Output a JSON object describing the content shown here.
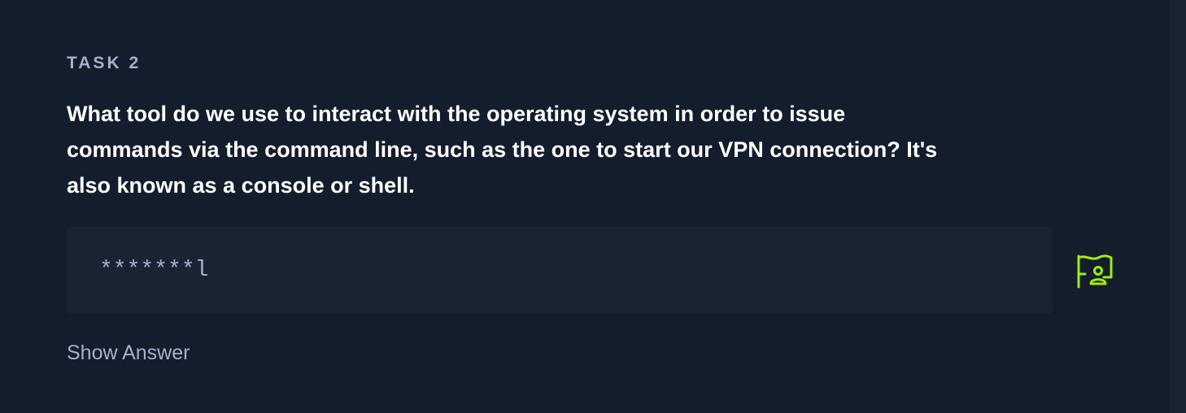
{
  "task": {
    "label": "TASK 2",
    "question": "What tool do we use to interact with the operating system in order to issue commands via the command line, such as the one to start our VPN connection? It's also known as a console or shell.",
    "answer_placeholder": "*******l",
    "show_answer_label": "Show Answer",
    "submit_icon": "flag-user-icon"
  },
  "colors": {
    "background": "#141d2b",
    "panel": "#1a2332",
    "muted_text": "#a4b1cd",
    "heading_text": "#ffffff",
    "accent": "#9fef00"
  }
}
